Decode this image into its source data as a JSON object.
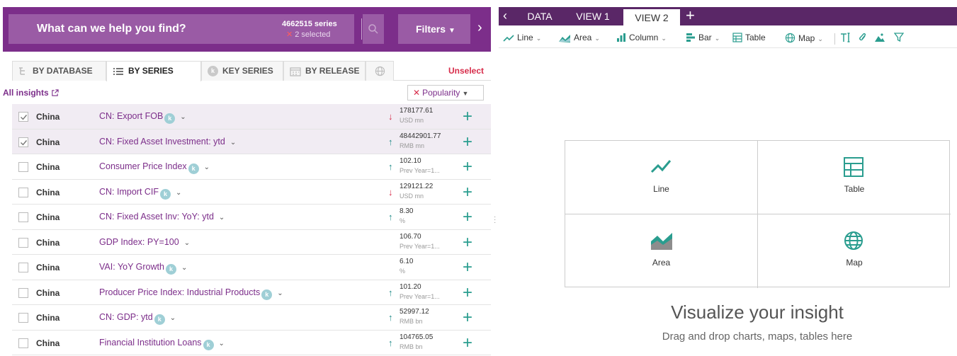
{
  "search": {
    "placeholder": "What can we help you find?",
    "series_count": "4662515 series",
    "selected": "2 selected",
    "filters_label": "Filters"
  },
  "tabs": [
    {
      "label": "BY DATABASE"
    },
    {
      "label": "BY SERIES"
    },
    {
      "label": "KEY SERIES"
    },
    {
      "label": "BY RELEASE"
    }
  ],
  "unselect_label": "Unselect",
  "insights_link": "All insights",
  "sort": {
    "label": "Popularity"
  },
  "rows": [
    {
      "region": "China",
      "name": "CN: Export FOB",
      "key": true,
      "trend": "down",
      "value": "178177.61",
      "unit": "USD mn",
      "checked": true
    },
    {
      "region": "China",
      "name": "CN: Fixed Asset Investment: ytd",
      "key": false,
      "trend": "up",
      "value": "48442901.77",
      "unit": "RMB mn",
      "checked": true
    },
    {
      "region": "China",
      "name": "Consumer Price Index",
      "key": true,
      "trend": "up",
      "value": "102.10",
      "unit": "Prev Year=1...",
      "checked": false
    },
    {
      "region": "China",
      "name": "CN: Import CIF",
      "key": true,
      "trend": "down",
      "value": "129121.22",
      "unit": "USD mn",
      "checked": false
    },
    {
      "region": "China",
      "name": "CN: Fixed Asset Inv: YoY: ytd",
      "key": false,
      "trend": "up",
      "value": "8.30",
      "unit": "%",
      "checked": false
    },
    {
      "region": "China",
      "name": "GDP Index: PY=100",
      "key": false,
      "trend": "",
      "value": "106.70",
      "unit": "Prev Year=1...",
      "checked": false
    },
    {
      "region": "China",
      "name": "VAI: YoY Growth",
      "key": true,
      "trend": "",
      "value": "6.10",
      "unit": "%",
      "checked": false
    },
    {
      "region": "China",
      "name": "Producer Price Index: Industrial Products",
      "key": true,
      "trend": "up",
      "value": "101.20",
      "unit": "Prev Year=1...",
      "checked": false
    },
    {
      "region": "China",
      "name": "CN: GDP: ytd",
      "key": true,
      "trend": "up",
      "value": "52997.12",
      "unit": "RMB bn",
      "checked": false
    },
    {
      "region": "China",
      "name": "Financial Institution Loans",
      "key": true,
      "trend": "up",
      "value": "104765.05",
      "unit": "RMB bn",
      "checked": false
    }
  ],
  "views": {
    "tabs": [
      "DATA",
      "VIEW 1",
      "VIEW 2"
    ],
    "active": "VIEW 2"
  },
  "toolbar": {
    "line": "Line",
    "area": "Area",
    "column": "Column",
    "bar": "Bar",
    "table": "Table",
    "map": "Map"
  },
  "grid": {
    "line": "Line",
    "table": "Table",
    "area": "Area",
    "map": "Map"
  },
  "empty_state": {
    "title": "Visualize your insight",
    "subtitle": "Drag and drop charts, maps, tables here"
  },
  "colors": {
    "brand_purple": "#7c2e8a",
    "view_bar": "#5a2767",
    "teal": "#2a9d8f",
    "down_red": "#d72c4a"
  }
}
